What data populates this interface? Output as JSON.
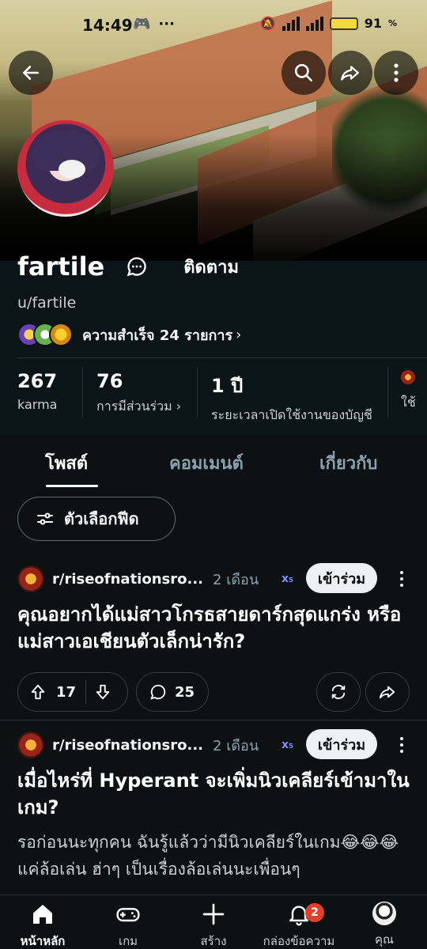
{
  "status_bar": {
    "time": "14:49",
    "battery": "91"
  },
  "profile": {
    "username": "fartile",
    "handle": "u/fartile",
    "follow_label": "ติดตาม",
    "achievements_label": "ความสำเร็จ 24 รายการ",
    "stats": [
      {
        "value": "267",
        "label": "karma"
      },
      {
        "value": "76",
        "label": "การมีส่วนร่วม"
      },
      {
        "value": "1 ปี",
        "label": "ระยะเวลาเปิดใช้งานของบัญชี"
      },
      {
        "value": "",
        "label": "ใช้"
      }
    ]
  },
  "tabs": [
    "โพสต์",
    "คอมเมนต์",
    "เกี่ยวกับ"
  ],
  "feed_options_label": "ตัวเลือกฟีด",
  "posts": [
    {
      "subreddit": "r/riseofnationsro...",
      "age": "2 เดือน",
      "join_label": "เข้าร่วม",
      "title": "คุณอยากได้แม่สาวโกรธสายดาร์กสุดแกร่ง หรือแม่สาวเอเชียนตัวเล็กน่ารัก?",
      "upvotes": "17",
      "comments": "25"
    },
    {
      "subreddit": "r/riseofnationsro...",
      "age": "2 เดือน",
      "join_label": "เข้าร่วม",
      "title": "เมื่อไหร่ที่ Hyperant จะเพิ่มนิวเคลียร์เข้ามาในเกม?",
      "body": "รอก่อนนะทุกคน ฉันรู้แล้วว่ามีนิวเคลียร์ในเกม😂😂😂แค่ล้อเล่น ฮ่าๆ เป็นเรื่องล้อเล่นนะเพื่อนๆ"
    }
  ],
  "bottom_nav": {
    "items": [
      "หน้าหลัก",
      "เกม",
      "สร้าง",
      "กล่องข้อความ",
      "คุณ"
    ],
    "inbox_badge": "2"
  },
  "colors": {
    "background": "#0b1416",
    "join_button": "#eef1f3",
    "badge": "#e0412a"
  }
}
